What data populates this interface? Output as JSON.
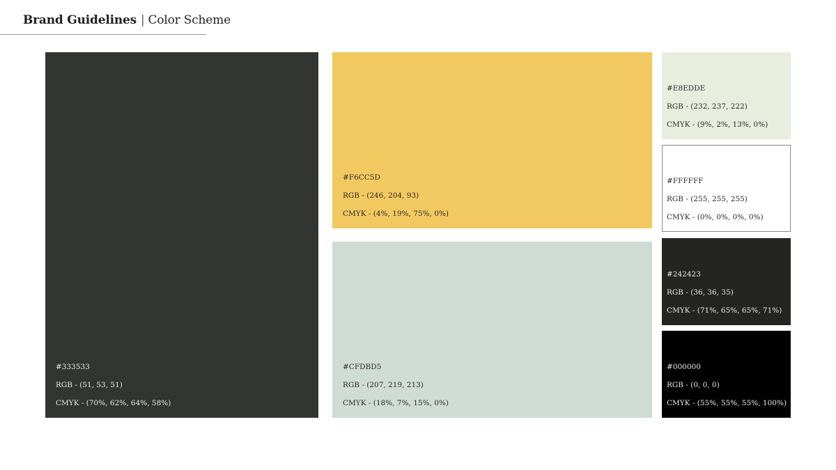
{
  "header": {
    "brand": "Brand Guidelines",
    "separator": "|",
    "section": "Color Scheme"
  },
  "swatches": [
    {
      "name": "charcoal",
      "color": "#333533",
      "hex": "#333533",
      "rgb": "RGB - (51, 53, 51)",
      "cmyk": "CMYK - (70%, 62%, 64%, 58%)"
    },
    {
      "name": "yellow",
      "color": "#F6CC5D",
      "hex": "#F6CC5D",
      "rgb": "RGB - (246, 204, 93)",
      "cmyk": "CMYK - (4%, 19%, 75%, 0%)"
    },
    {
      "name": "sage",
      "color": "#CFDBD5",
      "hex": "#CFDBD5",
      "rgb": "RGB - (207, 219, 213)",
      "cmyk": "CMYK - (18%, 7%, 15%, 0%)"
    },
    {
      "name": "mint",
      "color": "#E8EDDE",
      "hex": "#E8EDDE",
      "rgb": "RGB - (232, 237, 222)",
      "cmyk": "CMYK - (9%, 2%, 13%, 0%)"
    },
    {
      "name": "white",
      "color": "#FFFFFF",
      "hex": "#FFFFFF",
      "rgb": "RGB - (255, 255, 255)",
      "cmyk": "CMYK - (0%, 0%, 0%, 0%)"
    },
    {
      "name": "jet",
      "color": "#242423",
      "hex": "#242423",
      "rgb": "RGB - (36, 36, 35)",
      "cmyk": "CMYK - (71%, 65%, 65%, 71%)"
    },
    {
      "name": "black",
      "color": "#000000",
      "hex": "#000000",
      "rgb": "RGB - (0, 0, 0)",
      "cmyk": "CMYK - (55%, 55%, 55%, 100%)"
    }
  ]
}
